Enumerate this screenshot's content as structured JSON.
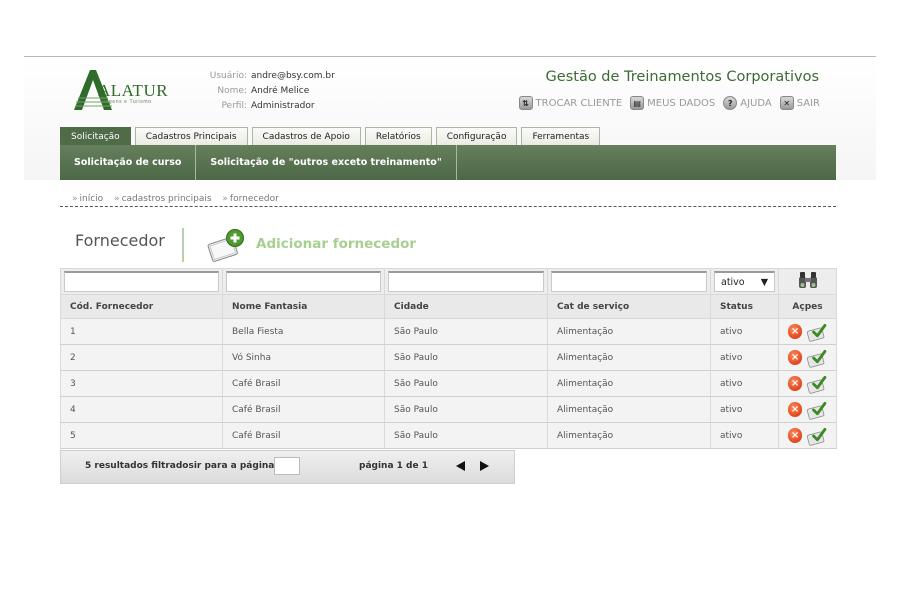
{
  "brand": {
    "logo_text": "ALATUR",
    "logo_sub": "Viagens e Turismo"
  },
  "user": {
    "usuario_label": "Usuário:",
    "usuario_value": "andre@bsy.com.br",
    "nome_label": "Nome:",
    "nome_value": "André Melice",
    "perfil_label": "Perfil:",
    "perfil_value": "Administrador"
  },
  "app_title": "Gestão de Treinamentos Corporativos",
  "top_links": [
    {
      "label": "TROCAR CLIENTE",
      "icon": "swap-icon"
    },
    {
      "label": "MEUS DADOS",
      "icon": "id-card-icon"
    },
    {
      "label": "AJUDA",
      "icon": "help-icon"
    },
    {
      "label": "SAIR",
      "icon": "exit-icon"
    }
  ],
  "tabs": [
    "Solicitação",
    "Cadastros Principais",
    "Cadastros de Apoio",
    "Relatórios",
    "Configuração",
    "Ferramentas"
  ],
  "subnav": [
    "Solicitação de curso",
    "Solicitação de \"outros exceto treinamento\""
  ],
  "breadcrumb": [
    "início",
    "cadastros principais",
    "fornecedor"
  ],
  "page": {
    "title": "Fornecedor",
    "add_label": "Adicionar fornecedor"
  },
  "filters": {
    "status_selected": "ativo"
  },
  "table": {
    "headers": [
      "Cód. Fornecedor",
      "Nome Fantasia",
      "Cidade",
      "Cat de serviço",
      "Status",
      "Açpes"
    ],
    "rows": [
      [
        "1",
        "Bella Fiesta",
        "São Paulo",
        "Alimentação",
        "ativo"
      ],
      [
        "2",
        "Vó Sinha",
        "São Paulo",
        "Alimentação",
        "ativo"
      ],
      [
        "3",
        "Café Brasil",
        "São Paulo",
        "Alimentação",
        "ativo"
      ],
      [
        "4",
        "Café Brasil",
        "São Paulo",
        "Alimentação",
        "ativo"
      ],
      [
        "5",
        "Café Brasil",
        "São Paulo",
        "Alimentação",
        "ativo"
      ]
    ]
  },
  "pager": {
    "results_label": "5 resultados filtradosir para a página:",
    "page_label": "página 1 de 1"
  },
  "colors": {
    "brand_green": "#4f6b47",
    "title_green": "#3c6b34",
    "add_green": "#a6cf90",
    "delete_orange": "#e0451e"
  }
}
